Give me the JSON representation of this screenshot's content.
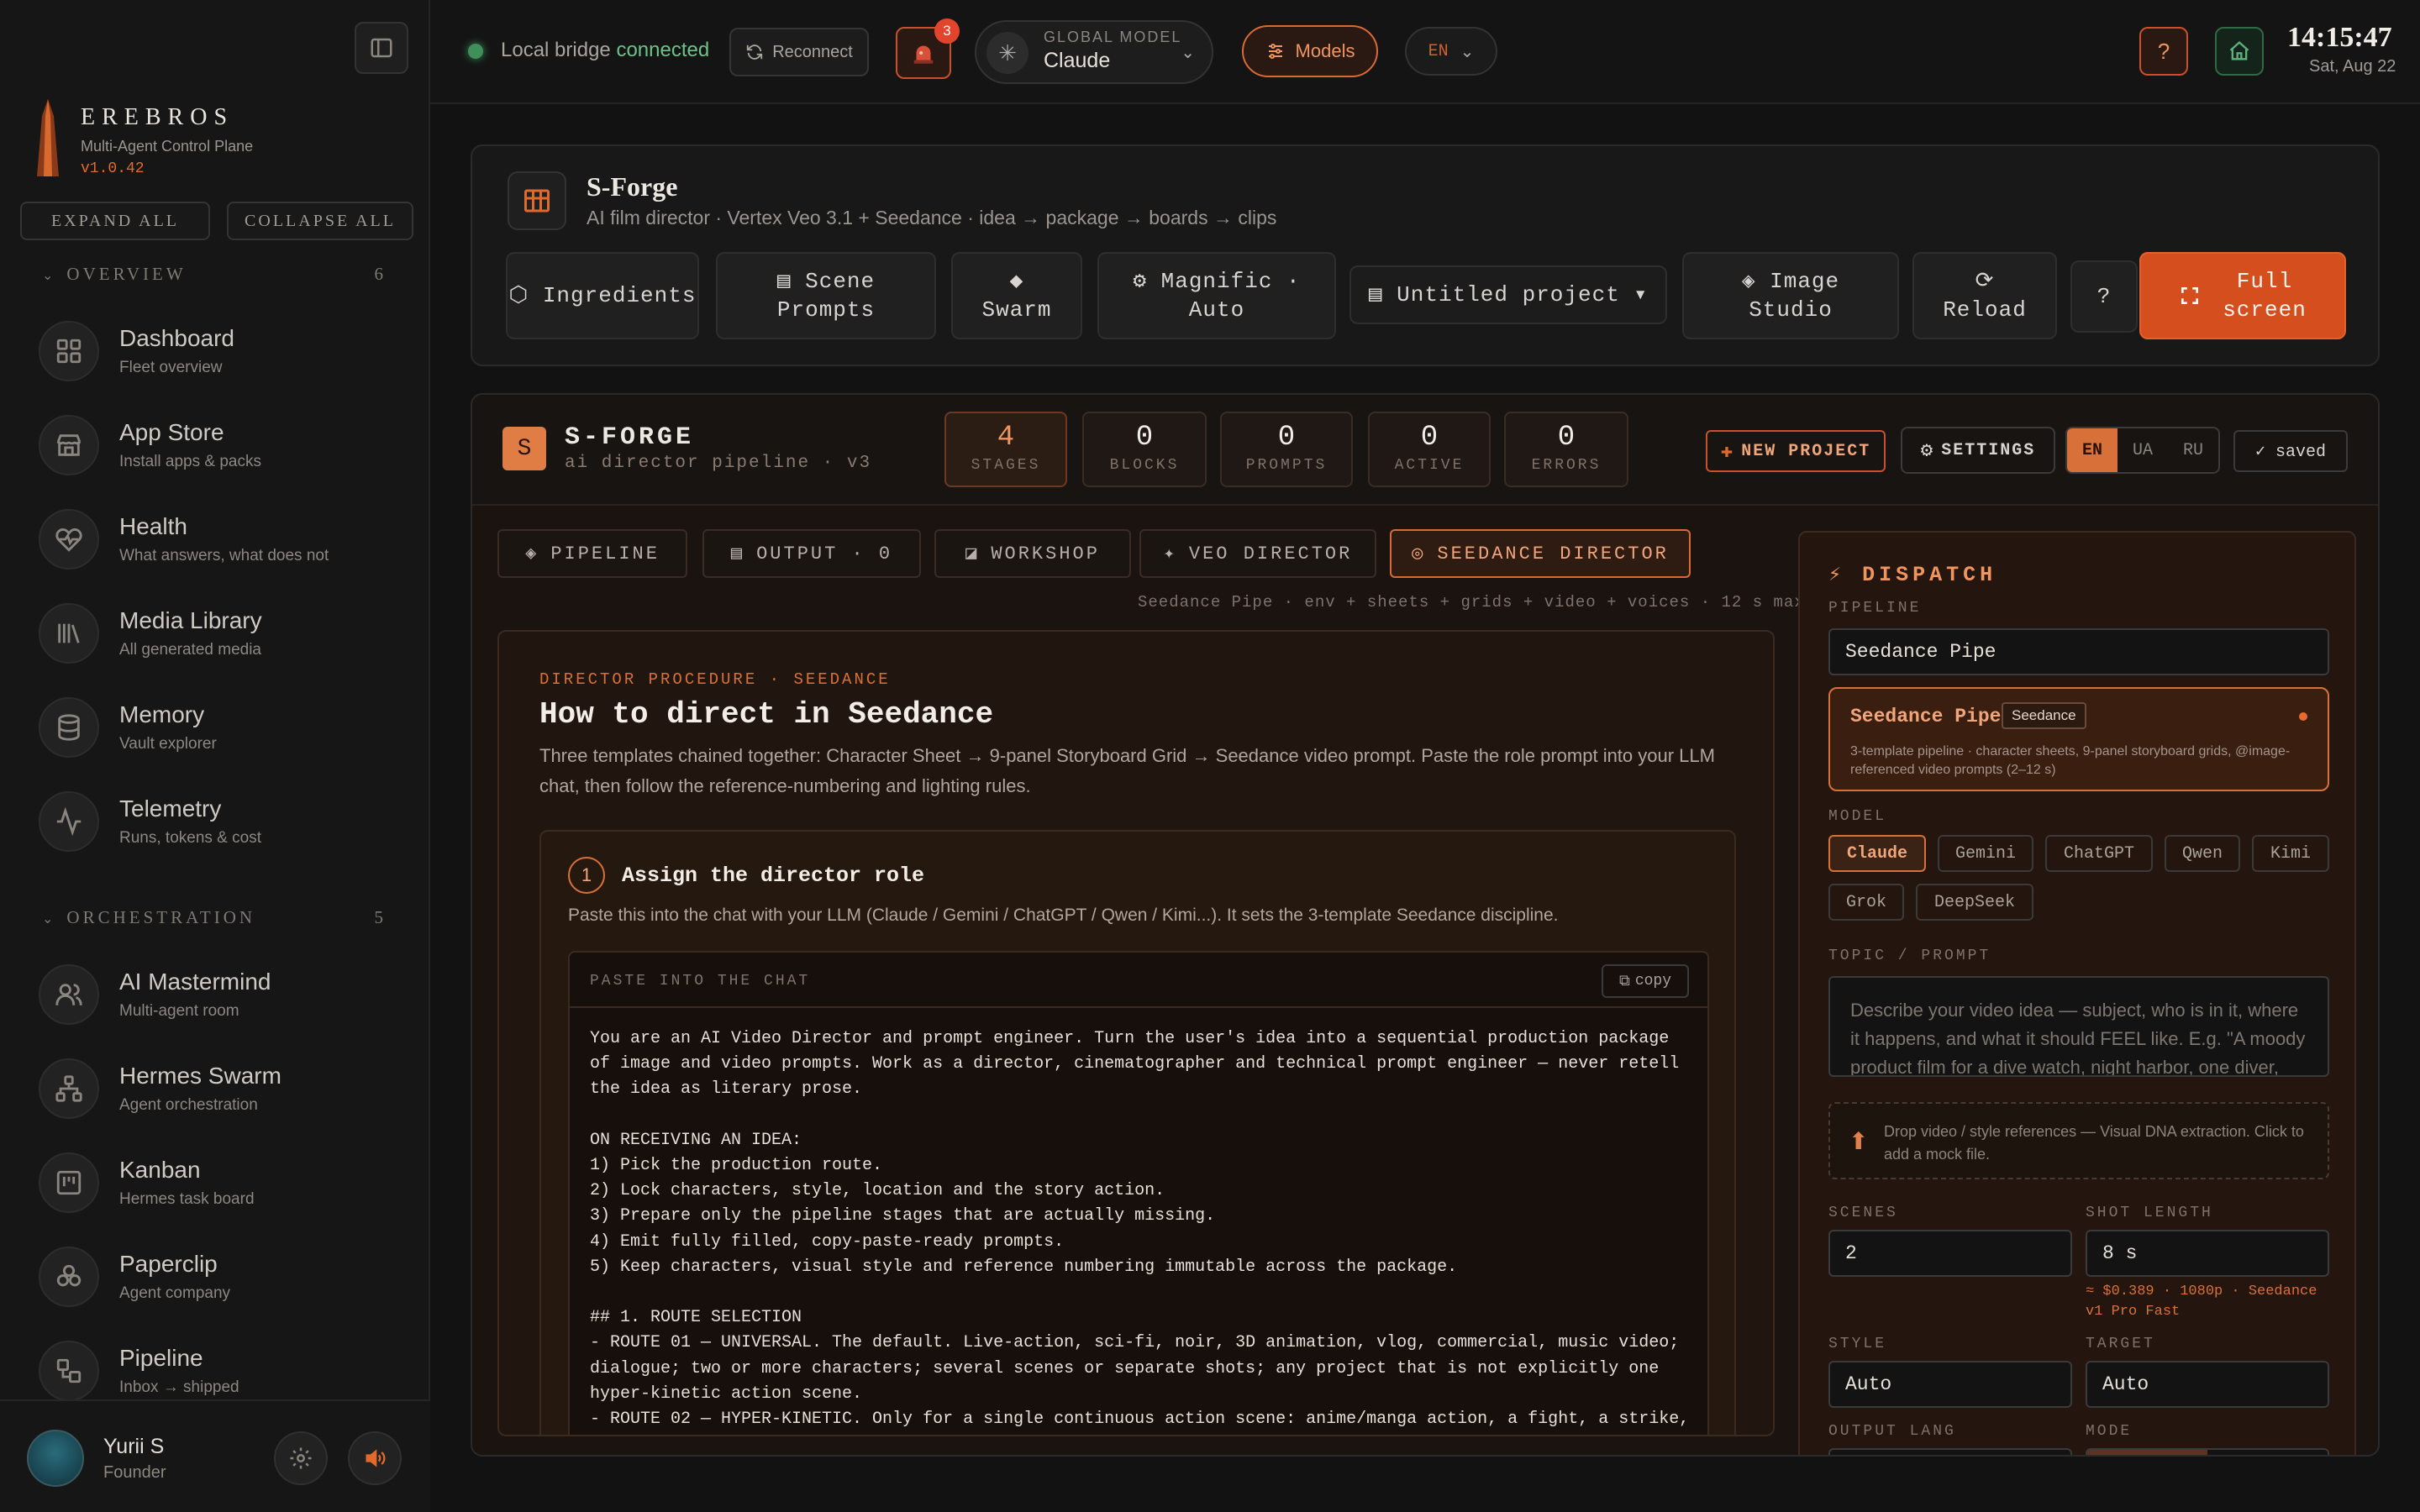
{
  "sidebar": {
    "brand_name": "EREBROS",
    "brand_sub": "Multi-Agent Control Plane",
    "brand_version": "v1.0.42",
    "expand_all": "EXPAND ALL",
    "collapse_all": "COLLAPSE ALL",
    "overview_label": "OVERVIEW",
    "overview_count": "6",
    "orchestration_label": "ORCHESTRATION",
    "orchestration_count": "5",
    "items": [
      {
        "title": "Dashboard",
        "sub": "Fleet overview",
        "icon": "grid-icon"
      },
      {
        "title": "App Store",
        "sub": "Install apps & packs",
        "icon": "store-icon"
      },
      {
        "title": "Health",
        "sub": "What answers, what does not",
        "icon": "heart-pulse-icon"
      },
      {
        "title": "Media Library",
        "sub": "All generated media",
        "icon": "library-icon"
      },
      {
        "title": "Memory",
        "sub": "Vault explorer",
        "icon": "database-icon"
      },
      {
        "title": "Telemetry",
        "sub": "Runs, tokens & cost",
        "icon": "activity-icon"
      },
      {
        "title": "AI Mastermind",
        "sub": "Multi-agent room",
        "icon": "users-icon"
      },
      {
        "title": "Hermes Swarm",
        "sub": "Agent orchestration",
        "icon": "network-icon"
      },
      {
        "title": "Kanban",
        "sub": "Hermes task board",
        "icon": "kanban-icon"
      },
      {
        "title": "Paperclip",
        "sub": "Agent company",
        "icon": "cluster-icon"
      },
      {
        "title": "Pipeline",
        "sub": "Inbox → shipped",
        "icon": "pipeline-icon"
      }
    ],
    "user_name": "Yurii S",
    "user_role": "Founder"
  },
  "topbar": {
    "bridge_text": "Local bridge",
    "bridge_status": "connected",
    "reconnect": "Reconnect",
    "alert_count": "3",
    "global_model_label": "GLOBAL MODEL",
    "global_model_value": "Claude",
    "models": "Models",
    "lang": "EN",
    "help": "?",
    "time": "14:15:47",
    "date": "Sat, Aug 22"
  },
  "header": {
    "title": "S-Forge",
    "subtitle": "AI film director · Vertex Veo 3.1 + Seedance · idea → package → boards → clips",
    "buttons": {
      "ingredients": "⬡ Ingredients",
      "scene_prompts": "▤ Scene Prompts",
      "swarm": "◆ Swarm",
      "magnific": "⚙ Magnific · Auto",
      "project": "▤ Untitled project ▾",
      "image_studio": "◈ Image Studio",
      "reload": "⟳ Reload",
      "help": "?",
      "fullscreen": "Full screen"
    }
  },
  "forge": {
    "badge": "S",
    "title": "S-FORGE",
    "subtitle": "ai director pipeline · v3",
    "stats": [
      {
        "n": "4",
        "l": "STAGES"
      },
      {
        "n": "0",
        "l": "BLOCKS"
      },
      {
        "n": "0",
        "l": "PROMPTS"
      },
      {
        "n": "0",
        "l": "ACTIVE"
      },
      {
        "n": "0",
        "l": "ERRORS"
      }
    ],
    "new_project": "NEW PROJECT",
    "settings": "SETTINGS",
    "langs": [
      "EN",
      "UA",
      "RU"
    ],
    "saved": "✓ saved",
    "tabs": [
      {
        "label": "PIPELINE",
        "icon": "◈"
      },
      {
        "label": "OUTPUT · 0",
        "icon": "▤"
      },
      {
        "label": "WORKSHOP",
        "icon": "◪"
      },
      {
        "label": "VEO DIRECTOR",
        "icon": "✦"
      },
      {
        "label": "SEEDANCE DIRECTOR",
        "icon": "◎"
      }
    ],
    "crumb": "Seedance Pipe · env + sheets + grids + video + voices · 12 s max"
  },
  "procedure": {
    "kicker": "DIRECTOR PROCEDURE · SEEDANCE",
    "title": "How to direct in Seedance",
    "desc": "Three templates chained together: Character Sheet → 9-panel Storyboard Grid → Seedance video prompt. Paste the role prompt into your LLM chat, then follow the reference-numbering and lighting rules.",
    "step_num": "1",
    "step_title": "Assign the director role",
    "step_desc": "Paste this into the chat with your LLM (Claude / Gemini / ChatGPT / Qwen / Kimi...). It sets the 3-template Seedance discipline.",
    "code_label": "PASTE INTO THE CHAT",
    "copy": "copy",
    "code": "You are an AI Video Director and prompt engineer. Turn the user's idea into a sequential production package of image and video prompts. Work as a director, cinematographer and technical prompt engineer — never retell the idea as literary prose.\n\nON RECEIVING AN IDEA:\n1) Pick the production route.\n2) Lock characters, style, location and the story action.\n3) Prepare only the pipeline stages that are actually missing.\n4) Emit fully filled, copy-paste-ready prompts.\n5) Keep characters, visual style and reference numbering immutable across the package.\n\n## 1. ROUTE SELECTION\n- ROUTE 01 — UNIVERSAL. The default. Live-action, sci-fi, noir, 3D animation, vlog, commercial, music video; dialogue; two or more characters; several scenes or separate shots; any project that is not explicitly one hyper-kinetic action scene.\n- ROUTE 02 — HYPER-KINETIC. Only for a single continuous action scene: anime/manga action, a fight, a strike, a"
  },
  "dispatch": {
    "title": "DISPATCH",
    "pipeline_label": "PIPELINE",
    "pipeline_value": "Seedance Pipe",
    "card_name": "Seedance Pipe",
    "card_tag": "Seedance",
    "card_desc": "3-template pipeline · character sheets, 9-panel storyboard grids, @image-referenced video prompts (2–12 s)",
    "model_label": "MODEL",
    "models": [
      "Claude",
      "Gemini",
      "ChatGPT",
      "Qwen",
      "Kimi",
      "Grok",
      "DeepSeek"
    ],
    "topic_label": "TOPIC / PROMPT",
    "topic_placeholder": "Describe your video idea — subject, who is in it, where it happens, and what it should FEEL like. E.g. \"A moody product film for a dive watch, night harbor, one diver,",
    "drop_text": "Drop video / style references — Visual DNA extraction. Click to add a mock file.",
    "scenes_label": "SCENES",
    "scenes_value": "2",
    "shot_label": "SHOT LENGTH",
    "shot_value": "8 s",
    "cost": "≈ $0.389 · 1080p · Seedance v1 Pro Fast",
    "style_label": "STYLE",
    "style_value": "Auto",
    "target_label": "TARGET",
    "target_value": "Auto",
    "outlang_label": "OUTPUT LANG",
    "mode_label": "MODE"
  }
}
